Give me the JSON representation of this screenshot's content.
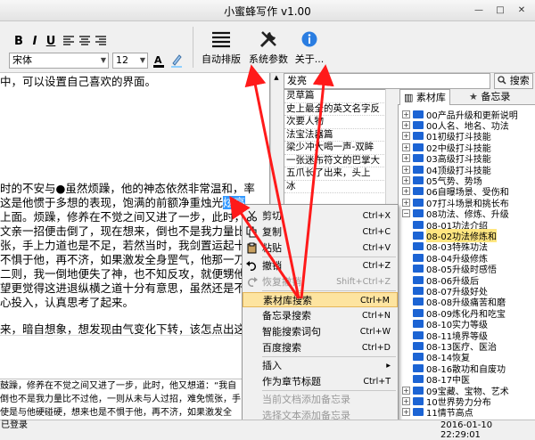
{
  "window": {
    "title": "小蜜蜂写作 v1.00",
    "minimize": "—",
    "maximize": "□",
    "close": "✕"
  },
  "toolbar": {
    "bold": "B",
    "italic": "I",
    "underline": "U",
    "font_name": "宋体",
    "font_size": "12",
    "auto_layout_label": "自动排版",
    "settings_label": "系统参数",
    "about_label": "关于..."
  },
  "editor": {
    "lines": [
      "中，可以设置自己喜欢的界面。",
      "时的不安与●虽然烦躁，他的神态依然非常温和，率",
      "这是他惯于多想的表现，饱满的前额净重烛光",
      "上面。烦躁，修养在不觉之间又进了一步，此时，",
      "文亲一招便击倒了，现在想来，倒也不是我力量比",
      "张，手上力道也是不足，若然当时，我剑置运起十",
      "不惧于他，再不济，如果激发全身罡气，他那一刀",
      "二则，我一倒地便失了神，也不知反攻，就便甥他",
      "望更觉得这进退纵横之道十分有意思，虽然还是不",
      "心投入，认真思考了起来。",
      "来，暗自想象，想发现由气变化下转，该怎点出这"
    ],
    "selected": "炫亮"
  },
  "bottom_text": {
    "lines": [
      "鼓躁，修养在不觉之间又进了一步，此时，他又想道：“我自",
      "倒也不是我力量比不过他，一则从未与人过招，难免慌张，手",
      "使是与他硬碰硬，想来也是不惧于他，再不济，如果激发全"
    ]
  },
  "search": {
    "value": "发亮",
    "button": "搜索"
  },
  "results": [
    "灵草篇",
    "史上最全的英文名字反",
    "次要人物",
    "法宝法器篇",
    "梁少冲大喝一声-双眸",
    "一张迷布符文的巴掌大",
    "五爪长了出来，头上",
    "冰"
  ],
  "tabs": {
    "library": "素材库",
    "memo": "备忘录"
  },
  "tree": [
    {
      "label": "00产品升级和更新说明",
      "exp": "+",
      "hl": false
    },
    {
      "label": "00人名、地名、功法",
      "exp": "+",
      "hl": false
    },
    {
      "label": "01初级打斗技能",
      "exp": "+",
      "hl": false
    },
    {
      "label": "02中级打斗技能",
      "exp": "+",
      "hl": false
    },
    {
      "label": "03高级打斗技能",
      "exp": "+",
      "hl": false
    },
    {
      "label": "04顶级打斗技能",
      "exp": "+",
      "hl": false
    },
    {
      "label": "05气势、势场",
      "exp": "+",
      "hl": false
    },
    {
      "label": "06自曝场景、受伤和",
      "exp": "+",
      "hl": false
    },
    {
      "label": "07打斗场景和挑长布",
      "exp": "+",
      "hl": false
    },
    {
      "label": "08功法、修炼、升级",
      "exp": "−",
      "hl": false
    },
    {
      "label": "08-01功法介绍",
      "exp": "",
      "hl": false
    },
    {
      "label": "08-02功法修炼和",
      "exp": "",
      "hl": true
    },
    {
      "label": "08-03特殊功法",
      "exp": "",
      "hl": false
    },
    {
      "label": "08-04升级修炼",
      "exp": "",
      "hl": false
    },
    {
      "label": "08-05升级时感悟",
      "exp": "",
      "hl": false
    },
    {
      "label": "08-06升级后",
      "exp": "",
      "hl": false
    },
    {
      "label": "08-07升级好处",
      "exp": "",
      "hl": false
    },
    {
      "label": "08-08升级痛苦和磨",
      "exp": "",
      "hl": false
    },
    {
      "label": "08-09炼化丹和吃宝",
      "exp": "",
      "hl": false
    },
    {
      "label": "08-10实力等级",
      "exp": "",
      "hl": false
    },
    {
      "label": "08-11境界等级",
      "exp": "",
      "hl": false
    },
    {
      "label": "08-13医疗、医治",
      "exp": "",
      "hl": false
    },
    {
      "label": "08-14恢复",
      "exp": "",
      "hl": false
    },
    {
      "label": "08-16散功和自废功",
      "exp": "",
      "hl": false
    },
    {
      "label": "08-17中医",
      "exp": "",
      "hl": false
    },
    {
      "label": "09宝藏、宝物、艺术",
      "exp": "+",
      "hl": false
    },
    {
      "label": "10世界势力分布",
      "exp": "+",
      "hl": false
    },
    {
      "label": "11情节高点",
      "exp": "+",
      "hl": false
    }
  ],
  "context_menu": [
    {
      "label": "剪切",
      "shortcut": "Ctrl+X",
      "disabled": false,
      "hot": false,
      "icon": "scissors-icon"
    },
    {
      "label": "复制",
      "shortcut": "Ctrl+C",
      "disabled": false,
      "hot": false,
      "icon": "copy-icon"
    },
    {
      "label": "粘贴",
      "shortcut": "Ctrl+V",
      "disabled": false,
      "hot": false,
      "icon": "paste-icon"
    },
    {
      "label": "撤销",
      "shortcut": "Ctrl+Z",
      "disabled": false,
      "hot": false,
      "icon": "undo-icon"
    },
    {
      "label": "恢复撤销",
      "shortcut": "Shift+Ctrl+Z",
      "disabled": true,
      "hot": false,
      "icon": "redo-icon"
    },
    {
      "label": "素材库搜索",
      "shortcut": "Ctrl+M",
      "disabled": false,
      "hot": true,
      "icon": ""
    },
    {
      "label": "备忘录搜索",
      "shortcut": "Ctrl+N",
      "disabled": false,
      "hot": false,
      "icon": ""
    },
    {
      "label": "智能搜索词句",
      "shortcut": "Ctrl+W",
      "disabled": false,
      "hot": false,
      "icon": ""
    },
    {
      "label": "百度搜索",
      "shortcut": "Ctrl+D",
      "disabled": false,
      "hot": false,
      "icon": ""
    },
    {
      "label": "插入",
      "shortcut": "▸",
      "disabled": false,
      "hot": false,
      "icon": ""
    },
    {
      "label": "作为章节标题",
      "shortcut": "Ctrl+T",
      "disabled": false,
      "hot": false,
      "icon": ""
    },
    {
      "label": "当前文档添加备忘录",
      "shortcut": "",
      "disabled": true,
      "hot": false,
      "icon": ""
    },
    {
      "label": "选择文本添加备忘录",
      "shortcut": "",
      "disabled": true,
      "hot": false,
      "icon": ""
    }
  ],
  "status": {
    "left": "已登录",
    "datetime": "2016-01-10 22:29:01"
  },
  "colors": {
    "accent": "#3399ff",
    "folder": "#1c64d4",
    "arrow": "#ff1a1a",
    "highlight": "#fde4a0"
  }
}
